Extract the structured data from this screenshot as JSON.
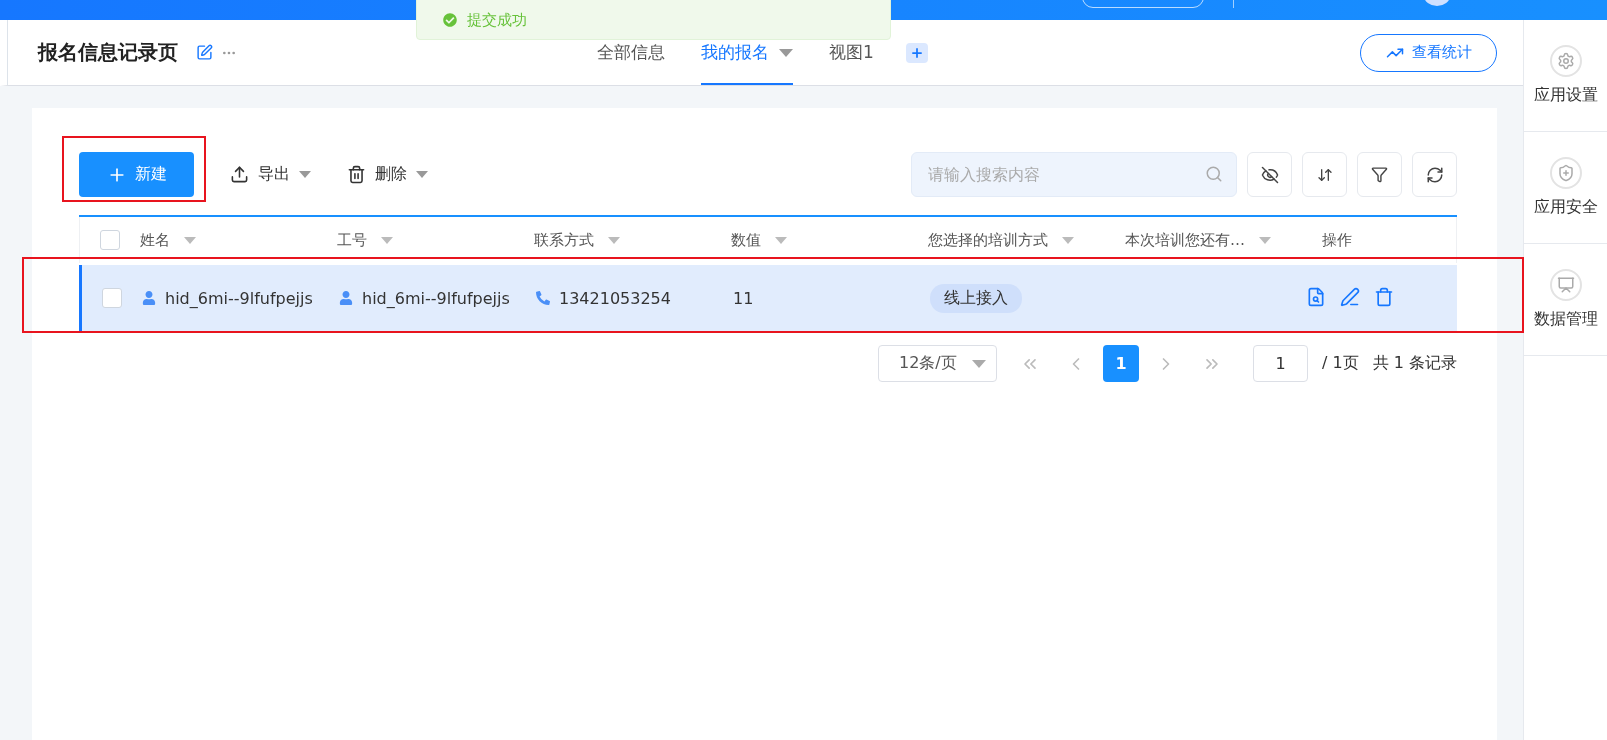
{
  "toast": {
    "text": "提交成功",
    "kind": "success"
  },
  "header": {
    "title": "报名信息记录页",
    "tabs": [
      {
        "label": "全部信息",
        "selected": false,
        "has_menu": false
      },
      {
        "label": "我的报名",
        "selected": true,
        "has_menu": true
      },
      {
        "label": "视图1",
        "selected": false,
        "has_menu": false
      }
    ],
    "stats_button": "查看统计"
  },
  "sidebar": {
    "items": [
      {
        "label": "应用设置",
        "kind": "settings"
      },
      {
        "label": "应用安全",
        "kind": "security"
      },
      {
        "label": "数据管理",
        "kind": "data"
      }
    ]
  },
  "toolbar": {
    "new_button": {
      "label": "新建",
      "annotated": true
    },
    "actions": [
      {
        "label": "导出",
        "kind": "export"
      },
      {
        "label": "删除",
        "kind": "delete"
      }
    ],
    "search": {
      "placeholder": "请输入搜索内容"
    },
    "tools": [
      {
        "kind": "hide"
      },
      {
        "kind": "sort"
      },
      {
        "kind": "filter"
      },
      {
        "kind": "refresh"
      }
    ]
  },
  "table": {
    "header_checked": false,
    "columns": [
      {
        "label": "姓名",
        "sortable": true
      },
      {
        "label": "工号",
        "sortable": true
      },
      {
        "label": "联系方式",
        "sortable": true
      },
      {
        "label": "数值",
        "sortable": true
      },
      {
        "label": "您选择的培训方式",
        "sortable": true
      },
      {
        "label": "本次培训您还有…",
        "sortable": true
      },
      {
        "label": "操作",
        "sortable": false
      }
    ],
    "rows": [
      {
        "checked": false,
        "highlighted": true,
        "annotated": true,
        "cells": [
          {
            "kind": "user",
            "text": "hid_6mi--9lfufpejjs"
          },
          {
            "kind": "user",
            "text": "hid_6mi--9lfufpejjs"
          },
          {
            "kind": "phone",
            "text": "13421053254"
          },
          {
            "kind": "text",
            "text": "11"
          },
          {
            "kind": "tag",
            "text": "线上接入"
          },
          {
            "kind": "blank"
          }
        ],
        "actions": [
          {
            "kind": "view"
          },
          {
            "kind": "edit"
          },
          {
            "kind": "delete"
          }
        ]
      }
    ]
  },
  "pagination": {
    "page_size": "12条/页",
    "pages": [
      {
        "label": "1",
        "selected": true
      }
    ],
    "jump_value": "1",
    "page_total": "/ 1页",
    "record_total": "共 1 条记录"
  }
}
